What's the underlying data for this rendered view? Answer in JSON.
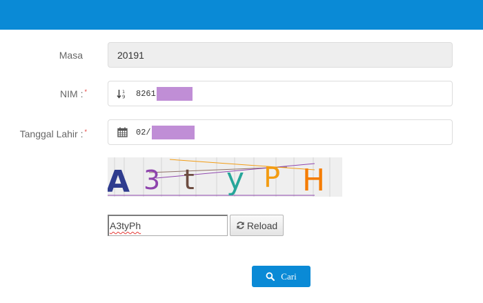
{
  "form": {
    "masa": {
      "label": "Masa",
      "value": "20191"
    },
    "nim": {
      "label": "NIM :",
      "required_mark": "*",
      "icon": "sort-numeric-icon",
      "value": "8261"
    },
    "tanggal_lahir": {
      "label": "Tanggal Lahir :",
      "required_mark": "*",
      "icon": "calendar-icon",
      "value": "02/"
    },
    "captcha": {
      "text": "A3tyPH",
      "letters": [
        {
          "char": "A",
          "color": "#2f3c8e"
        },
        {
          "char": "3",
          "color": "#8e44ad"
        },
        {
          "char": "t",
          "color": "#6d4c41"
        },
        {
          "char": "y",
          "color": "#26a69a"
        },
        {
          "char": "P",
          "color": "#f39c12"
        },
        {
          "char": "H",
          "color": "#f57c00"
        }
      ]
    },
    "captcha_input": {
      "value": "A3tyPh"
    },
    "reload_button": {
      "label": "Reload",
      "icon": "refresh-icon"
    },
    "search_button": {
      "label": "Cari",
      "icon": "search-icon"
    }
  },
  "colors": {
    "header": "#0a8ad6",
    "primary_button": "#0a8ad6",
    "required": "#e53935",
    "redaction": "#c08ed6"
  }
}
